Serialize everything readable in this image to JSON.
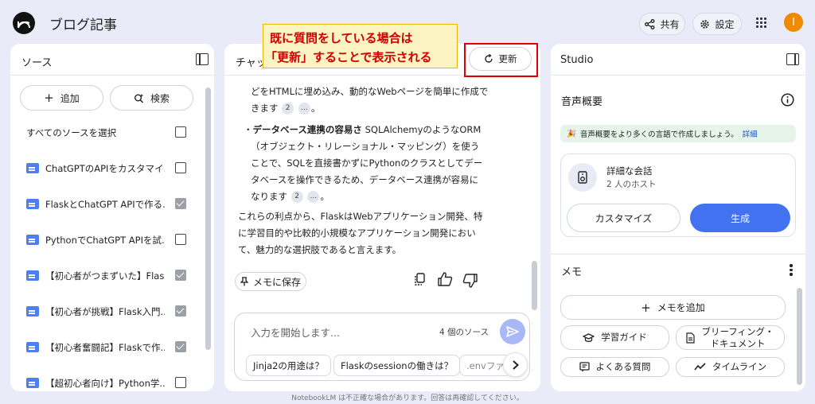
{
  "header": {
    "notebook_title": "ブログ記事",
    "share_label": "共有",
    "settings_label": "設定",
    "avatar_initial": "I",
    "avatar_color": "#f08a00"
  },
  "sources": {
    "title": "ソース",
    "add_label": "追加",
    "search_label": "検索",
    "select_all_label": "すべてのソースを選択",
    "items": [
      {
        "label": "ChatGPTのAPIをカスタマイ...",
        "checked": false
      },
      {
        "label": "FlaskとChatGPT APIで作る...",
        "checked": true
      },
      {
        "label": "PythonでChatGPT APIを試...",
        "checked": false
      },
      {
        "label": "【初心者がつまずいた】Flas...",
        "checked": true
      },
      {
        "label": "【初心者が挑戦】Flask入門...",
        "checked": true
      },
      {
        "label": "【初心者奮闘記】Flaskで作...",
        "checked": true
      },
      {
        "label": "【超初心者向け】Python学...",
        "checked": false
      }
    ]
  },
  "chat": {
    "title_partial": "チャッ",
    "refresh_label": "更新",
    "lines": {
      "l1": "どをHTMLに埋め込み、動的なWebページを簡単に作成で",
      "l2": "きます",
      "bullet_bold": "データベース連携の容易さ",
      "bullet_rest": " SQLAlchemyのようなORM",
      "l4": "（オブジェクト・リレーショナル・マッピング）を使う",
      "l5": "ことで、SQLを直接書かずにPythonのクラスとしてデー",
      "l6": "タベースを操作できるため、データベース連携が容易に",
      "l7": "なります",
      "p1": "これらの利点から、FlaskはWebアプリケーション開発、特",
      "p2": "に学習目的や比較的小規模なアプリケーション開発におい",
      "p3": "て、魅力的な選択肢であると言えます。"
    },
    "cite_num": "2",
    "cite_more": "...",
    "period": "。",
    "save_note_label": "メモに保存",
    "input_placeholder": "入力を開始します...",
    "source_count": "4 個のソース",
    "suggestions": [
      "Jinja2の用途は？",
      "Flaskのsessionの働きは？",
      ".envファ"
    ]
  },
  "annotation": {
    "line1": "既に質問をしている場合は",
    "line2": "「更新」することで表示される"
  },
  "studio": {
    "title": "Studio",
    "audio_title": "音声概要",
    "banner_text": "音声概要をより多くの言語で作成しましょう。",
    "banner_link": "詳細",
    "card_title": "詳細な会話",
    "card_subtitle": "2 人のホスト",
    "customize_label": "カスタマイズ",
    "generate_label": "生成",
    "notes_title": "メモ",
    "add_note_label": "メモを追加",
    "study_guide_label": "学習ガイド",
    "briefing_line1": "ブリーフィング・",
    "briefing_line2": "ドキュメント",
    "faq_label": "よくある質問",
    "timeline_label": "タイムライン"
  },
  "footer": {
    "disclaimer": "NotebookLM は不正確な場合があります。回答は再確認してください。"
  }
}
